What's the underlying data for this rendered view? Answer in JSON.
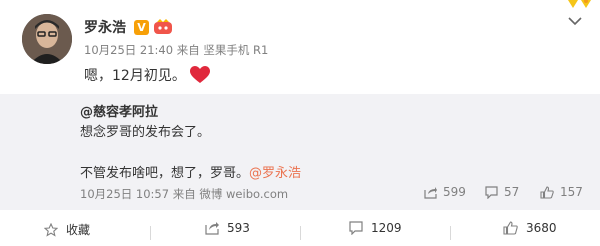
{
  "post": {
    "username": "罗永浩",
    "verified_mark": "V",
    "meta": "10月25日 21:40 来自 坚果手机 R1",
    "content": "嗯，12月初见。"
  },
  "quote": {
    "author": "@慈容孝阿拉",
    "line1": "想念罗哥的发布会了。",
    "line2_prefix": "不管发布啥吧，想了，罗哥。",
    "mention": "@罗永浩",
    "meta": "10月25日 10:57 来自 微博 weibo.com",
    "reposts": "599",
    "comments": "57",
    "likes": "157"
  },
  "actions": {
    "favorite_label": "收藏",
    "repost_count": "593",
    "comment_count": "1209",
    "like_count": "3680"
  },
  "colors": {
    "accent": "#eb7350",
    "heart": "#e0283c",
    "verified": "#f7a008",
    "quote_bg": "#f2f2f5"
  }
}
